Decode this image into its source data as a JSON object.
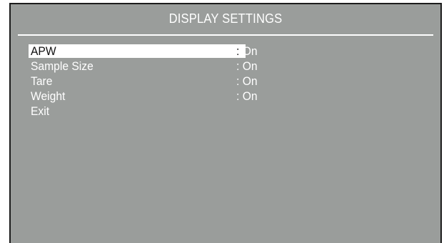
{
  "header": {
    "title": "DISPLAY SETTINGS"
  },
  "menu": {
    "items": [
      {
        "label": "APW",
        "separator": ":",
        "value": "On",
        "selected": true
      },
      {
        "label": "Sample Size",
        "separator": ":",
        "value": "On",
        "selected": false
      },
      {
        "label": "Tare",
        "separator": ":",
        "value": "On",
        "selected": false
      },
      {
        "label": "Weight",
        "separator": ":",
        "value": "On",
        "selected": false
      },
      {
        "label": "Exit",
        "separator": "",
        "value": "",
        "selected": false
      }
    ]
  },
  "colors": {
    "screen_background": "#9a9d9b",
    "text": "#ffffff",
    "selection_background": "#ffffff",
    "selected_text": "#111111"
  }
}
